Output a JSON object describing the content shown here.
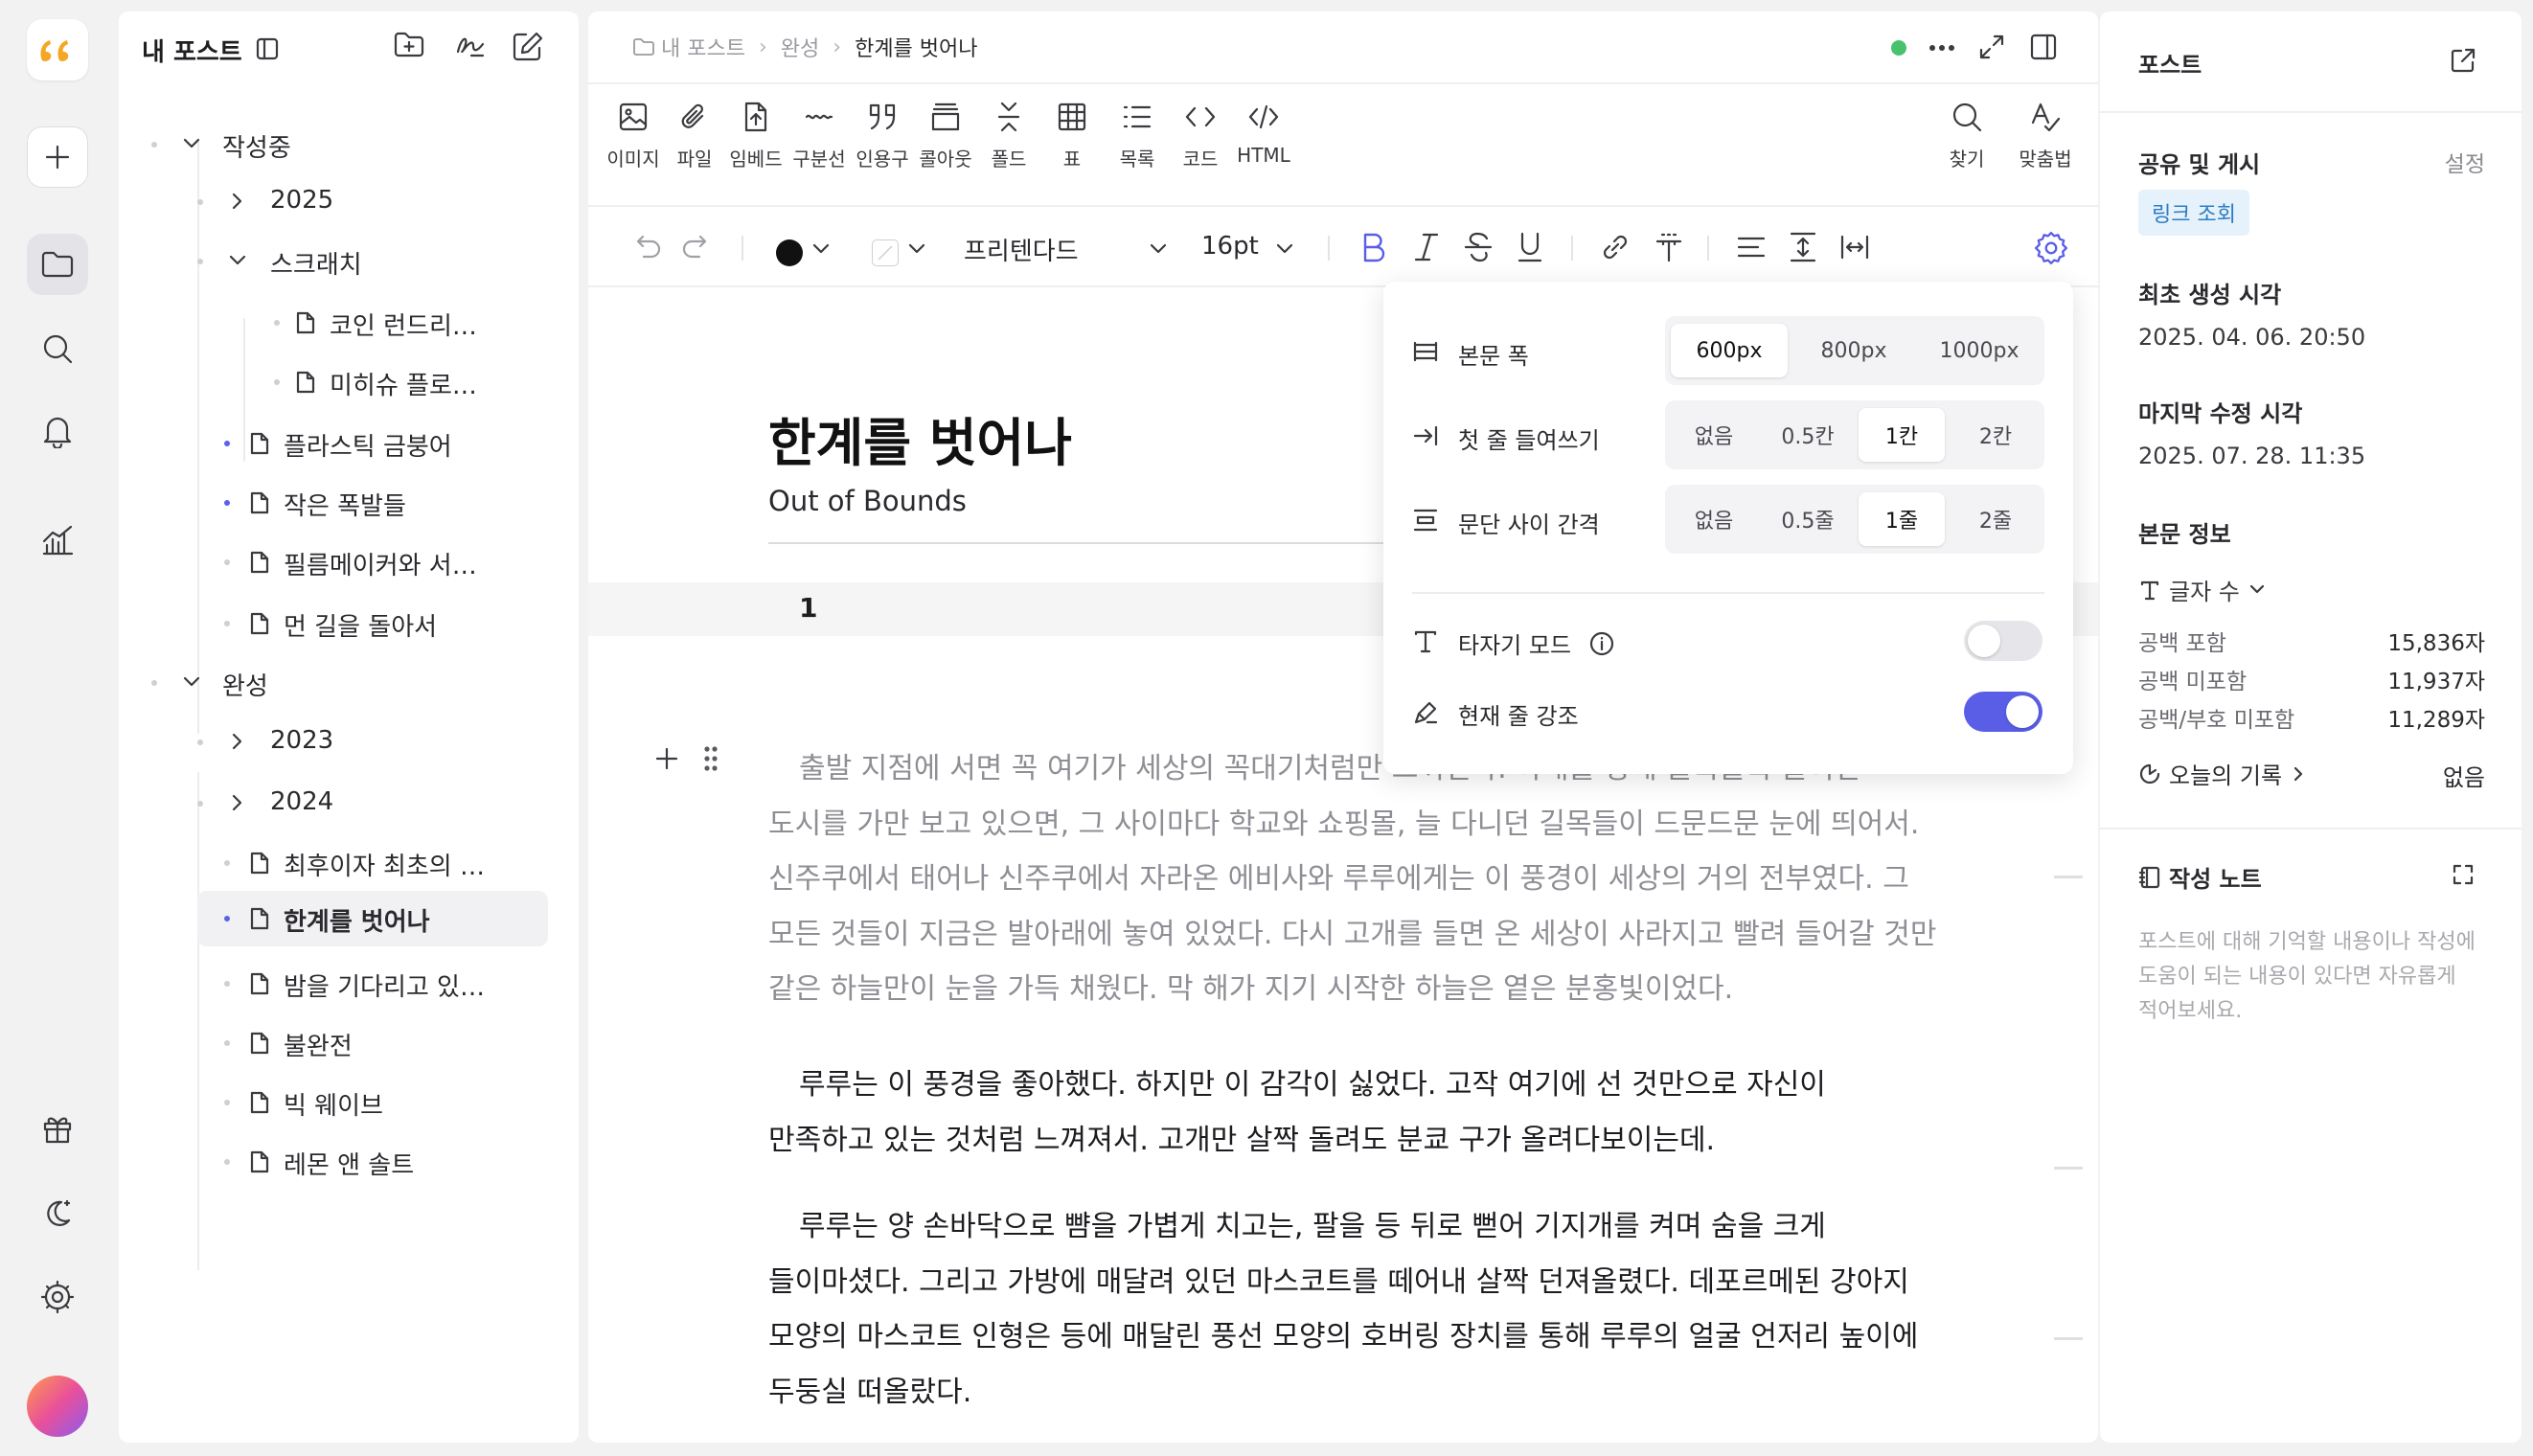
{
  "rail": {
    "logo_icon": "quote-bubble-logo",
    "items": [
      "plus-icon",
      "folder-icon",
      "search-icon",
      "bell-icon",
      "chart-icon"
    ],
    "bottom": [
      "gift-icon",
      "theme-icon",
      "settings-icon"
    ],
    "accent": "#f5a623"
  },
  "file_panel": {
    "title": "내 포스트",
    "tree": [
      {
        "label": "작성중",
        "type": "folder",
        "expanded": true
      },
      {
        "label": "2025",
        "type": "folder",
        "expanded": false
      },
      {
        "label": "스크래치",
        "type": "folder",
        "expanded": true
      },
      {
        "label": "코인 런드리…",
        "type": "doc"
      },
      {
        "label": "미히슈 플로…",
        "type": "doc"
      },
      {
        "label": "플라스틱 금붕어",
        "type": "doc"
      },
      {
        "label": "작은 폭발들",
        "type": "doc"
      },
      {
        "label": "필름메이커와 서…",
        "type": "doc"
      },
      {
        "label": "먼 길을 돌아서",
        "type": "doc"
      },
      {
        "label": "완성",
        "type": "folder",
        "expanded": true
      },
      {
        "label": "2023",
        "type": "folder",
        "expanded": false
      },
      {
        "label": "2024",
        "type": "folder",
        "expanded": false
      },
      {
        "label": "최후이자 최초의 …",
        "type": "doc"
      },
      {
        "label": "한계를 벗어나",
        "type": "doc",
        "selected": true
      },
      {
        "label": "밤을 기다리고 있…",
        "type": "doc"
      },
      {
        "label": "불완전",
        "type": "doc"
      },
      {
        "label": "빅 웨이브",
        "type": "doc"
      },
      {
        "label": "레몬 앤 솔트",
        "type": "doc"
      }
    ]
  },
  "editor": {
    "breadcrumb": [
      "내 포스트",
      "완성",
      "한계를 벗어나"
    ],
    "toolbar": [
      "이미지",
      "파일",
      "임베드",
      "구분선",
      "인용구",
      "콜아웃",
      "폴드",
      "표",
      "목록",
      "코드",
      "HTML"
    ],
    "toolbar_right": [
      "찾기",
      "맞춤법"
    ],
    "format": {
      "font": "프리텐다드",
      "size": "16pt"
    },
    "title": "한계를 벗어나",
    "subtitle": "Out of Bounds",
    "chapter": "1",
    "paragraphs": [
      "출발 지점에 서면 꼭 여기가 세상의 꼭대기처럼만 느껴진다. 아래를 향해 올록볼록 늘어선 도시를 가만 보고 있으면, 그 사이마다 학교와 쇼핑몰, 늘 다니던 길목들이 드문드문 눈에 띄어서. 신주쿠에서 태어나 신주쿠에서 자라온 에비사와 루루에게는 이 풍경이 세상의 거의 전부였다. 그 모든 것들이 지금은 발아래에 놓여 있었다. 다시 고개를 들면 온 세상이 사라지고 빨려 들어갈 것만 같은 하늘만이 눈을 가득 채웠다. 막 해가 지기 시작한 하늘은 옅은 분홍빛이었다.",
      "루루는 이 풍경을 좋아했다. 하지만 이 감각이 싫었다. 고작 여기에 선 것만으로 자신이 만족하고 있는 것처럼 느껴져서. 고개만 살짝 돌려도 분쿄 구가 올려다보이는데.",
      "루루는 양 손바닥으로 뺨을 가볍게 치고는, 팔을 등 뒤로 뻗어 기지개를 켜며 숨을 크게 들이마셨다. 그리고 가방에 매달려 있던 마스코트를 떼어내 살짝 던져올렸다. 데포르메된 강아지 모양의 마스코트 인형은 등에 매달린 풍선 모양의 호버링 장치를 통해 루루의 얼굴 언저리 높이에 두둥실 떠올랐다."
    ]
  },
  "settings": {
    "width": {
      "label": "본문 폭",
      "options": [
        "600px",
        "800px",
        "1000px"
      ],
      "selected": "600px"
    },
    "indent": {
      "label": "첫 줄 들여쓰기",
      "options": [
        "없음",
        "0.5칸",
        "1칸",
        "2칸"
      ],
      "selected": "1칸"
    },
    "spacing": {
      "label": "문단 사이 간격",
      "options": [
        "없음",
        "0.5줄",
        "1줄",
        "2줄"
      ],
      "selected": "1줄"
    },
    "typewriter": {
      "label": "타자기 모드",
      "on": false
    },
    "highlight": {
      "label": "현재 줄 강조",
      "on": true
    },
    "accent": "#5a5ee6"
  },
  "right_panel": {
    "title": "포스트",
    "share": {
      "label": "공유 및 게시",
      "action": "설정",
      "badge": "링크 조회"
    },
    "created": {
      "label": "최초 생성 시각",
      "value": "2025. 04. 06. 20:50"
    },
    "modified": {
      "label": "마지막 수정 시각",
      "value": "2025. 07. 28. 11:35"
    },
    "info": {
      "label": "본문 정보",
      "count_label": "글자 수",
      "rows": [
        {
          "label": "공백 포함",
          "value": "15,836자"
        },
        {
          "label": "공백 미포함",
          "value": "11,937자"
        },
        {
          "label": "공백/부호 미포함",
          "value": "11,289자"
        }
      ],
      "today_label": "오늘의 기록",
      "today_value": "없음"
    },
    "notes": {
      "label": "작성 노트",
      "placeholder": "포스트에 대해 기억할 내용이나 작성에 도움이 되는 내용이 있다면 자유롭게 적어보세요."
    }
  }
}
